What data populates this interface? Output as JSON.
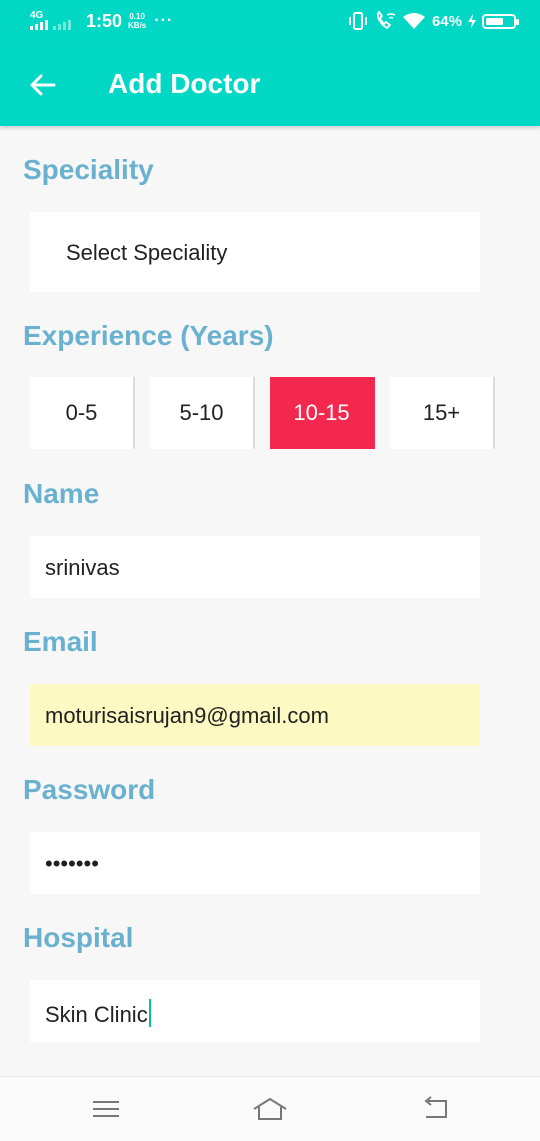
{
  "status_bar": {
    "network": "4G",
    "time": "1:50",
    "speed_value": "0.10",
    "speed_unit": "KB/s",
    "more": "···",
    "battery_pct": "64%",
    "battery_level": 0.64
  },
  "app_bar": {
    "title": "Add Doctor",
    "back_icon": "arrow-left-icon",
    "background": "#00d7c4"
  },
  "form": {
    "speciality": {
      "label": "Speciality",
      "value": "Select Speciality"
    },
    "experience": {
      "label": "Experience (Years)",
      "options": [
        "0-5",
        "5-10",
        "10-15",
        "15+"
      ],
      "selected": "10-15",
      "selected_color": "#f4284f"
    },
    "name": {
      "label": "Name",
      "value": "srinivas"
    },
    "email": {
      "label": "Email",
      "value": "moturisaisrujan9@gmail.com"
    },
    "password": {
      "label": "Password",
      "value": "•••••••"
    },
    "hospital": {
      "label": "Hospital",
      "value": "Skin Clinic"
    }
  },
  "colors": {
    "label": "#6ab1d0",
    "autofill": "#fdf9c3"
  },
  "nav_bar": {
    "icons": [
      "menu-icon",
      "home-icon",
      "back-icon"
    ]
  }
}
